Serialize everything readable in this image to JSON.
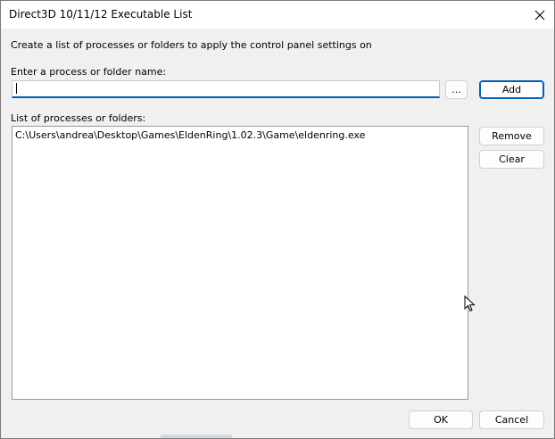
{
  "window": {
    "title": "Direct3D 10/11/12 Executable List"
  },
  "instructions": "Create a list of processes or folders to apply the control panel settings on",
  "input_section": {
    "label": "Enter a process or folder name:",
    "value": "",
    "browse_label": "...",
    "add_label": "Add"
  },
  "list_section": {
    "label": "List of processes or folders:",
    "items": [
      "C:\\Users\\andrea\\Desktop\\Games\\EldenRing\\1.02.3\\Game\\eldenring.exe"
    ],
    "remove_label": "Remove",
    "clear_label": "Clear"
  },
  "footer": {
    "ok_label": "OK",
    "cancel_label": "Cancel"
  },
  "colors": {
    "accent": "#005fb8",
    "dialog_bg": "#f0f0f0"
  }
}
